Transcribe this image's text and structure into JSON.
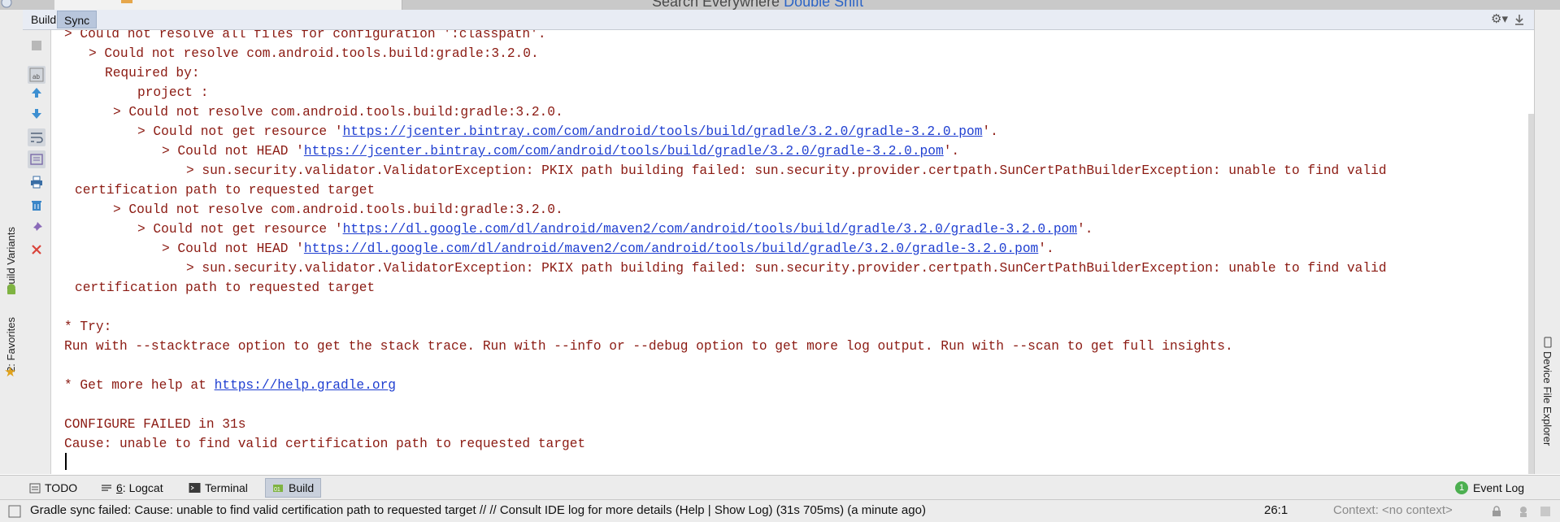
{
  "window": {
    "search_label": "Search Everywhere",
    "search_shortcut": "Double Shift"
  },
  "build_panel": {
    "tabs": [
      {
        "label": "Build",
        "active": false
      },
      {
        "label": "Sync",
        "active": true
      }
    ]
  },
  "left_stripe": {
    "build_variants": "Build Variants",
    "favorites": "2: Favorites"
  },
  "right_stripe": {
    "device_file_explorer": "Device File Explorer"
  },
  "console": {
    "lines": [
      {
        "text": "> Could not resolve all files for configuration ':classpath'."
      },
      {
        "text": "> Could not resolve com.android.tools.build:gradle:3.2.0."
      },
      {
        "text": "Required by:"
      },
      {
        "text": "project :"
      },
      {
        "text": "> Could not resolve com.android.tools.build:gradle:3.2.0."
      },
      {
        "pre": "> Could not get resource '",
        "url": "https://jcenter.bintray.com/com/android/tools/build/gradle/3.2.0/gradle-3.2.0.pom",
        "post": "'."
      },
      {
        "pre": "> Could not HEAD '",
        "url": "https://jcenter.bintray.com/com/android/tools/build/gradle/3.2.0/gradle-3.2.0.pom",
        "post": "'."
      },
      {
        "text": "> sun.security.validator.ValidatorException: PKIX path building failed: sun.security.provider.certpath.SunCertPathBuilderException: unable to find valid"
      },
      {
        "text": "certification path to requested target"
      },
      {
        "text": "> Could not resolve com.android.tools.build:gradle:3.2.0."
      },
      {
        "pre": "> Could not get resource '",
        "url": "https://dl.google.com/dl/android/maven2/com/android/tools/build/gradle/3.2.0/gradle-3.2.0.pom",
        "post": "'."
      },
      {
        "pre": "> Could not HEAD '",
        "url": "https://dl.google.com/dl/android/maven2/com/android/tools/build/gradle/3.2.0/gradle-3.2.0.pom",
        "post": "'."
      },
      {
        "text": "> sun.security.validator.ValidatorException: PKIX path building failed: sun.security.provider.certpath.SunCertPathBuilderException: unable to find valid"
      },
      {
        "text": "certification path to requested target"
      },
      {
        "text": "* Try:"
      },
      {
        "text": "Run with --stacktrace option to get the stack trace. Run with --info or --debug option to get more log output. Run with --scan to get full insights."
      },
      {
        "pre": "* Get more help at ",
        "url": "https://help.gradle.org",
        "post": ""
      },
      {
        "text": "CONFIGURE FAILED in 31s"
      },
      {
        "text": "Cause: unable to find valid certification path to requested target"
      }
    ]
  },
  "bottom_tabs": [
    {
      "label": "TODO",
      "icon": "todo-icon"
    },
    {
      "mnemonic": "6",
      "label": ": Logcat",
      "icon": "logcat-icon"
    },
    {
      "label": "Terminal",
      "icon": "terminal-icon"
    },
    {
      "label": "Build",
      "icon": "build-icon",
      "active": true
    }
  ],
  "event_log": {
    "count": "1",
    "label": "Event Log"
  },
  "status_bar": {
    "message": "Gradle sync failed: Cause: unable to find valid certification path to requested target // // Consult IDE log for more details (Help | Show Log) (31s 705ms) (a minute ago)",
    "position": "26:1",
    "context": "Context: <no context>"
  },
  "colors": {
    "error_text": "#8b1a12",
    "link": "#1f3fd1",
    "active_tab": "#b8c6dc"
  }
}
